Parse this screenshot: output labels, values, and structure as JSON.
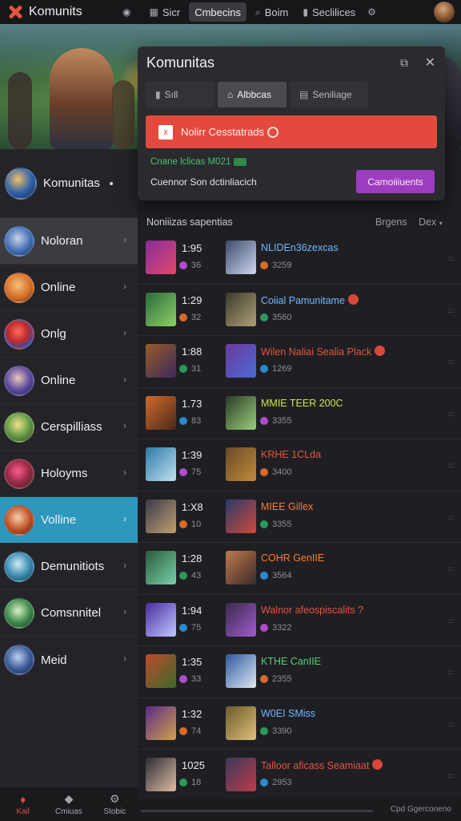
{
  "topbar": {
    "app_title": "Komunits",
    "items": [
      {
        "label": "",
        "icon": "eye-icon"
      },
      {
        "label": "Sicr",
        "icon": "grid-icon"
      },
      {
        "label": "Cmbecins",
        "icon": ""
      },
      {
        "label": "Boim",
        "icon": "search-icon"
      },
      {
        "label": "Seclilices",
        "icon": "chart-icon"
      }
    ]
  },
  "sidebar": {
    "header": {
      "title": "Komunitas"
    },
    "items": [
      {
        "label": "Noloran"
      },
      {
        "label": "Online"
      },
      {
        "label": "Onlg"
      },
      {
        "label": "Online"
      },
      {
        "label": "Cerspilliass"
      },
      {
        "label": "Holoyms"
      },
      {
        "label": "Volline"
      },
      {
        "label": "Demunitiots"
      },
      {
        "label": "Comsnnitel"
      },
      {
        "label": "Meid"
      }
    ],
    "chevron": "›"
  },
  "modal": {
    "title": "Komunitas",
    "expand_icon": "⧉",
    "close_icon": "✕",
    "tabs": [
      {
        "label": "Sıll"
      },
      {
        "label": "Albbcas"
      },
      {
        "label": "Seniliage"
      }
    ],
    "alert": {
      "text": "Nolirr Cesstatrads",
      "icon": "x"
    },
    "green_text": "Cnane lclicas M021",
    "description": "Cuennor Son dctinliacich",
    "button": "Camoiiiuents"
  },
  "list": {
    "title": "Noniiizas sapentias",
    "options": [
      "Brgens",
      "Dex"
    ],
    "rows": [
      {
        "time": "1:95",
        "meta": "36",
        "name": "NLIDEn36zexcas",
        "count": "3259",
        "name_color": "#6fb7ff",
        "badge": false
      },
      {
        "time": "1:29",
        "meta": "32",
        "name": "Coiial Pamunitame",
        "count": "3560",
        "name_color": "#6fb7ff",
        "badge": true
      },
      {
        "time": "1:88",
        "meta": "31",
        "name": "Wilen Naliai Sealia Plack",
        "count": "1269",
        "name_color": "#e2553f",
        "badge": true
      },
      {
        "time": "1.73",
        "meta": "83",
        "name": "MMIE TEER 200C",
        "count": "3355",
        "name_color": "#c9e84a",
        "badge": false
      },
      {
        "time": "1:39",
        "meta": "75",
        "name": "KRHE 1CLda",
        "count": "3400",
        "name_color": "#e2553f",
        "badge": false
      },
      {
        "time": "1:X8",
        "meta": "10",
        "name": "MIEE Gillex",
        "count": "3355",
        "name_color": "#ff7b2d",
        "badge": false
      },
      {
        "time": "1:28",
        "meta": "43",
        "name": "COHR GenIIE",
        "count": "3564",
        "name_color": "#ff7b2d",
        "badge": false
      },
      {
        "time": "1:94",
        "meta": "75",
        "name": "Walnor afeospiscalits ?",
        "count": "3322",
        "name_color": "#e2553f",
        "badge": false
      },
      {
        "time": "1:35",
        "meta": "33",
        "name": "KTHE CanIIE",
        "count": "2355",
        "name_color": "#5ad06e",
        "badge": false
      },
      {
        "time": "1:32",
        "meta": "74",
        "name": "W0EI SMiss",
        "count": "3390",
        "name_color": "#6fb7ff",
        "badge": false
      },
      {
        "time": "1025",
        "meta": "18",
        "name": "Talloor aficass Seamiaat",
        "count": "2953",
        "name_color": "#e2553f",
        "badge": true
      }
    ],
    "row_end": "::::"
  },
  "bottom_tabs": [
    {
      "label": "Kail",
      "icon": "pin-icon"
    },
    {
      "label": "Cmiuas",
      "icon": "tag-icon"
    },
    {
      "label": "Stobic",
      "icon": "settings-icon"
    }
  ],
  "footer_text": "Cpd Ggerconeno",
  "colors": {
    "accent_blue": "#2d97bd",
    "alert_red": "#e34a3d",
    "button_purple": "#9c3cbe",
    "success_green": "#49c36a"
  }
}
